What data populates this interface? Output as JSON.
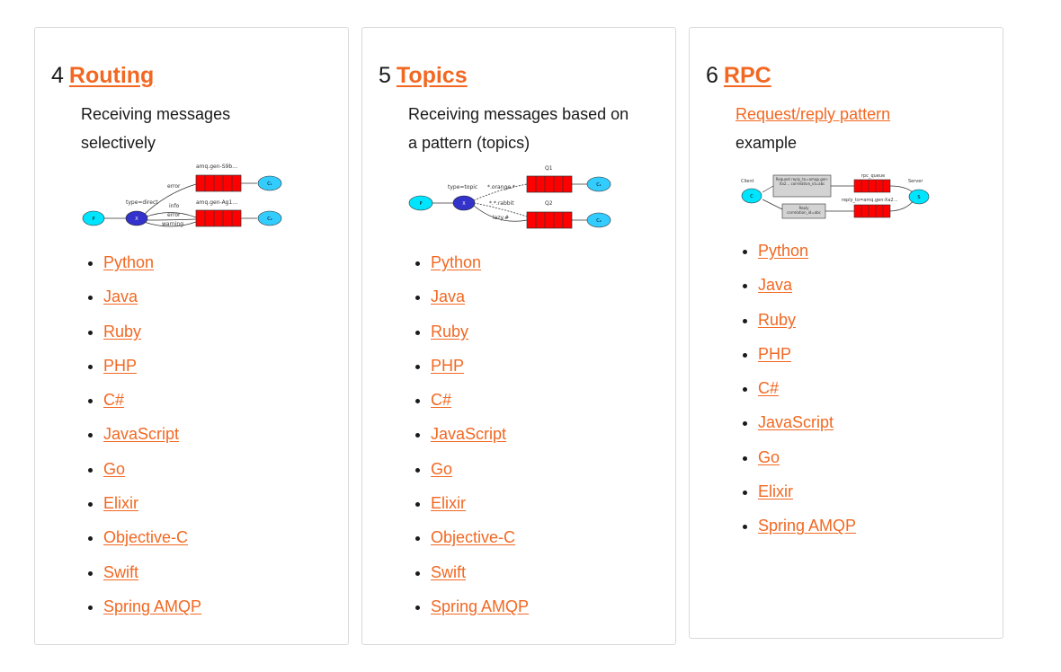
{
  "cards": [
    {
      "number": "4",
      "title": "Routing",
      "description": "Receiving messages selectively",
      "diagram": {
        "producer": "P",
        "exchange": "X",
        "type_label": "type=direct",
        "queue1": "amq.gen-S9b…",
        "queue2": "amq.gen-Ag1…",
        "consumer1": "C₁",
        "consumer2": "C₂",
        "binding1": "error",
        "binding2a": "info",
        "binding2b": "error",
        "binding2c": "warning"
      },
      "languages": [
        "Python",
        "Java",
        "Ruby",
        "PHP",
        "C#",
        "JavaScript",
        "Go",
        "Elixir",
        "Objective-C",
        "Swift",
        "Spring AMQP"
      ]
    },
    {
      "number": "5",
      "title": "Topics",
      "description": "Receiving messages based on a pattern (topics)",
      "diagram": {
        "producer": "P",
        "exchange": "X",
        "type_label": "type=topic",
        "queue1": "Q1",
        "queue2": "Q2",
        "consumer1": "C₁",
        "consumer2": "C₂",
        "binding1": "*.orange.*",
        "binding2a": "*.*.rabbit",
        "binding2b": "lazy.#"
      },
      "languages": [
        "Python",
        "Java",
        "Ruby",
        "PHP",
        "C#",
        "JavaScript",
        "Go",
        "Elixir",
        "Objective-C",
        "Swift",
        "Spring AMQP"
      ]
    },
    {
      "number": "6",
      "title": "RPC",
      "description_link": "Request/reply pattern",
      "description_rest": "example",
      "diagram": {
        "client_label": "Client",
        "client": "C",
        "server_label": "Server",
        "server": "S",
        "request_box": "Request reply_to=amqp.gen-Xa2… correlation_id=abc",
        "reply_box": "Reply correlation_id=abc",
        "queue_label": "rpc_queue",
        "reply_queue_label": "reply_to=amq.gen-Xa2…"
      },
      "languages": [
        "Python",
        "Java",
        "Ruby",
        "PHP",
        "C#",
        "JavaScript",
        "Go",
        "Elixir",
        "Spring AMQP"
      ]
    }
  ],
  "colors": {
    "link": "#f26822",
    "queue": "#ff0000",
    "node_light": "#00e5ff",
    "exchange": "#3333cc"
  }
}
